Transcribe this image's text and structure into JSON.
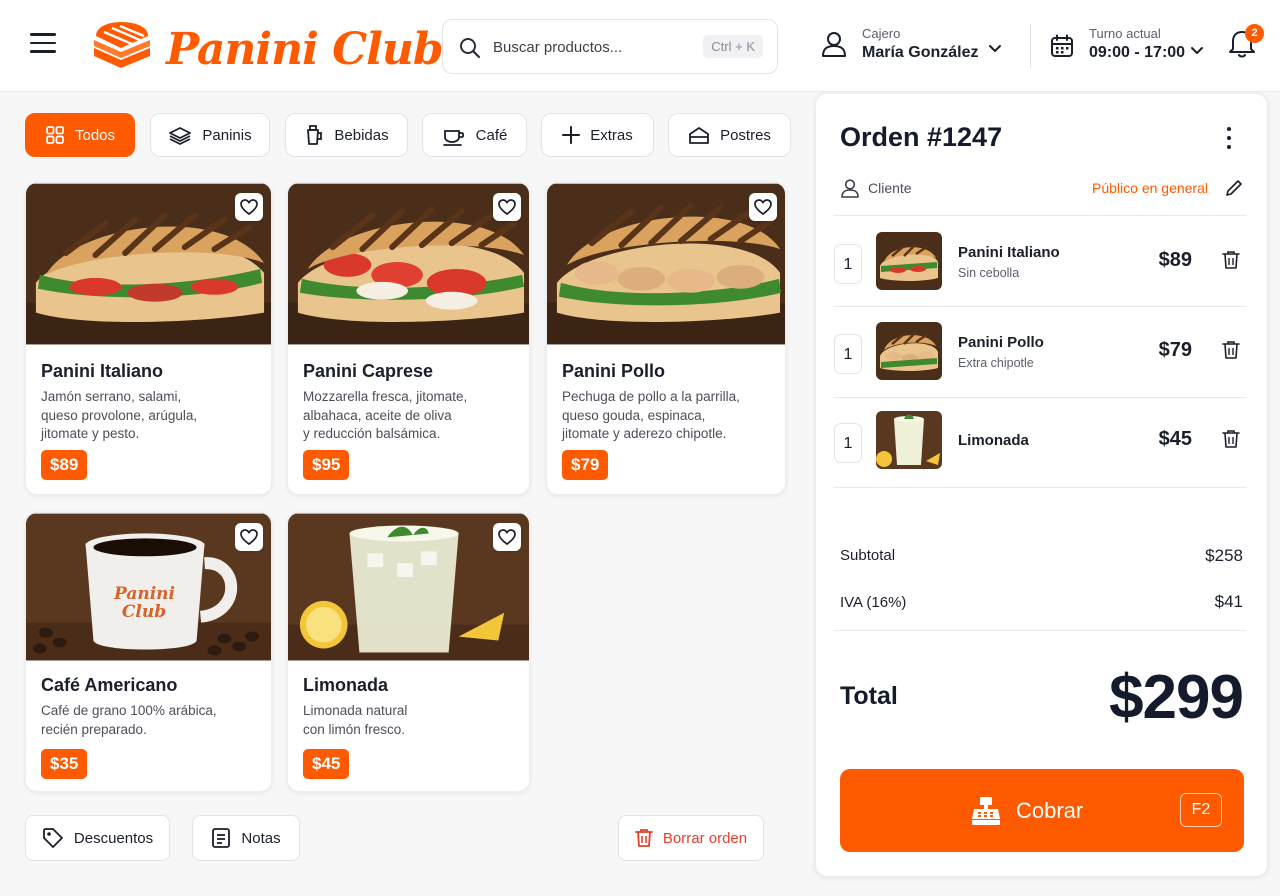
{
  "header": {
    "logo_text": "Panini Club",
    "search_placeholder": "Buscar productos...",
    "search_shortcut": "Ctrl + K",
    "cashier_label": "Cajero",
    "cashier_name": "María González",
    "shift_label": "Turno actual",
    "shift_time": "09:00 - 17:00",
    "notification_count": "2"
  },
  "categories": [
    {
      "label": "Todos",
      "icon": "grid-icon",
      "active": true
    },
    {
      "label": "Paninis",
      "icon": "sandwich-icon",
      "active": false
    },
    {
      "label": "Bebidas",
      "icon": "drink-icon",
      "active": false
    },
    {
      "label": "Café",
      "icon": "coffee-cup-icon",
      "active": false
    },
    {
      "label": "Extras",
      "icon": "plus-icon",
      "active": false
    },
    {
      "label": "Postres",
      "icon": "cake-icon",
      "active": false
    }
  ],
  "products": [
    {
      "name": "Panini Italiano",
      "desc": "Jamón serrano, salami,\nqueso provolone, arúgula,\njitomate y pesto.",
      "price": "$89"
    },
    {
      "name": "Panini Caprese",
      "desc": "Mozzarella fresca, jitomate,\nalbahaca, aceite de oliva\ny reducción balsámica.",
      "price": "$95"
    },
    {
      "name": "Panini Pollo",
      "desc": "Pechuga de pollo a la parrilla,\nqueso gouda, espinaca,\njitomate y aderezo chipotle.",
      "price": "$79"
    },
    {
      "name": "Café Americano",
      "desc": "Café de grano 100% arábica,\nrecién preparado.",
      "price": "$35",
      "cup_text": "Panini Club"
    },
    {
      "name": "Limonada",
      "desc": "Limonada natural\ncon limón fresco.",
      "price": "$45"
    }
  ],
  "actions": {
    "discounts": "Descuentos",
    "notes": "Notas",
    "clear_order": "Borrar orden"
  },
  "order": {
    "title": "Orden #1247",
    "client_label": "Cliente",
    "client_value": "Público en general",
    "items": [
      {
        "qty": "1",
        "name": "Panini Italiano",
        "note": "Sin cebolla",
        "price": "$89"
      },
      {
        "qty": "1",
        "name": "Panini Pollo",
        "note": "Extra chipotle",
        "price": "$79"
      },
      {
        "qty": "1",
        "name": "Limonada",
        "note": "",
        "price": "$45"
      }
    ],
    "subtotal_label": "Subtotal",
    "subtotal_value": "$258",
    "tax_label": "IVA (16%)",
    "tax_value": "$41",
    "total_label": "Total",
    "total_value": "$299",
    "charge_label": "Cobrar",
    "charge_shortcut": "F2"
  },
  "colors": {
    "accent": "#ff5a00",
    "danger": "#e5402c",
    "text": "#1b1f2a"
  }
}
